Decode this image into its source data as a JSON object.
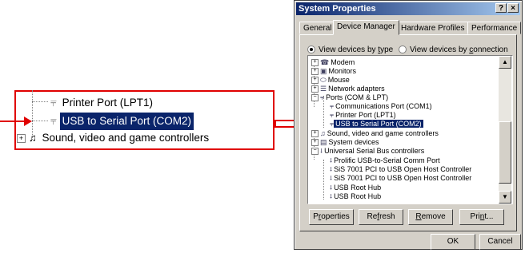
{
  "zoom": {
    "rows": [
      {
        "label": "Printer Port (LPT1)"
      },
      {
        "label": "USB to Serial Port (COM2)"
      },
      {
        "label": "Sound, video and game controllers"
      }
    ]
  },
  "colors": {
    "callout_red": "#e00000",
    "selection": "#0a246a",
    "title_bar": "#0a246a",
    "face": "#d4d0c8"
  },
  "dialog": {
    "title": "System Properties",
    "help_btn": "?",
    "close_btn": "×",
    "tabs": [
      "General",
      "Device Manager",
      "Hardware Profiles",
      "Performance"
    ],
    "radio_by_type": {
      "pre": "View devices by ",
      "u": "t",
      "post": "ype"
    },
    "radio_by_connection": {
      "pre": "View devices by ",
      "u": "c",
      "post": "onnection"
    },
    "tree": [
      {
        "label": "Modem",
        "icon": "modem-icon"
      },
      {
        "label": "Monitors",
        "icon": "monitor-icon"
      },
      {
        "label": "Mouse",
        "icon": "mouse-icon"
      },
      {
        "label": "Network adapters",
        "icon": "network-icon"
      },
      {
        "label": "Ports (COM & LPT)",
        "icon": "port-icon"
      },
      {
        "label": "Communications Port (COM1)",
        "icon": "port-icon"
      },
      {
        "label": "Printer Port (LPT1)",
        "icon": "port-icon"
      },
      {
        "label": "USB to Serial Port (COM2)",
        "icon": "port-icon"
      },
      {
        "label": "Sound, video and game controllers",
        "icon": "sound-icon"
      },
      {
        "label": "System devices",
        "icon": "system-icon"
      },
      {
        "label": "Universal Serial Bus controllers",
        "icon": "usb-icon"
      },
      {
        "label": "Prolific USB-to-Serial Comm Port",
        "icon": "usb-icon"
      },
      {
        "label": "SiS 7001 PCI to USB Open Host Controller",
        "icon": "usb-icon"
      },
      {
        "label": "SiS 7001 PCI to USB Open Host Controller",
        "icon": "usb-icon"
      },
      {
        "label": "USB Root Hub",
        "icon": "usb-icon"
      },
      {
        "label": "USB Root Hub",
        "icon": "usb-icon"
      }
    ],
    "buttons": {
      "properties": {
        "pre": "P",
        "u": "r",
        "post": "operties"
      },
      "refresh": {
        "pre": "Re",
        "u": "f",
        "post": "resh"
      },
      "remove": {
        "pre": "",
        "u": "R",
        "post": "emove"
      },
      "print": {
        "pre": "Pri",
        "u": "n",
        "post": "t..."
      },
      "ok": "OK",
      "cancel": "Cancel"
    }
  }
}
